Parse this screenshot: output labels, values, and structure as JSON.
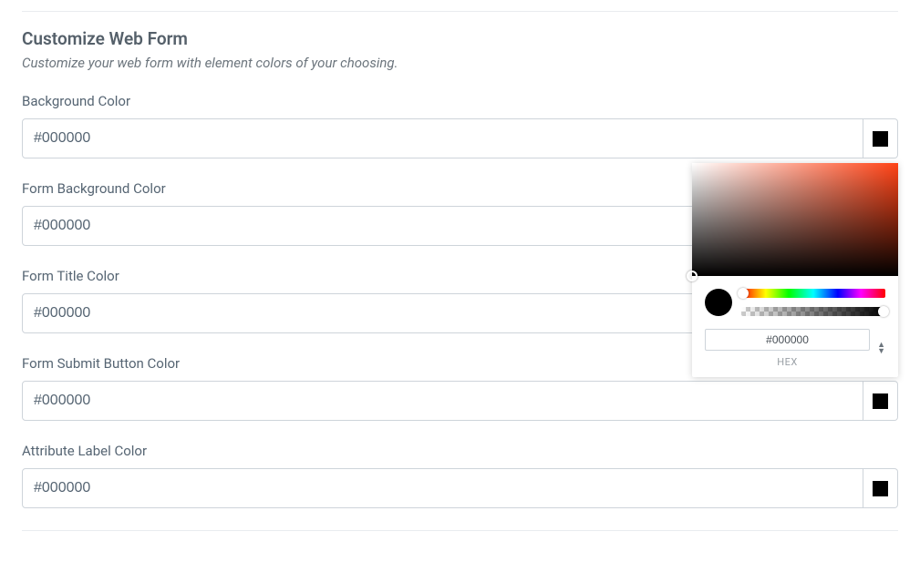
{
  "section": {
    "title": "Customize Web Form",
    "description": "Customize your web form with element colors of your choosing."
  },
  "fields": [
    {
      "label": "Background Color",
      "value": "#000000",
      "swatch": "#000000",
      "show_swatch": true
    },
    {
      "label": "Form Background Color",
      "value": "#000000",
      "swatch": "#000000",
      "show_swatch": false
    },
    {
      "label": "Form Title Color",
      "value": "#000000",
      "swatch": "#000000",
      "show_swatch": false
    },
    {
      "label": "Form Submit Button Color",
      "value": "#000000",
      "swatch": "#000000",
      "show_swatch": true
    },
    {
      "label": "Attribute Label Color",
      "value": "#000000",
      "swatch": "#000000",
      "show_swatch": true
    }
  ],
  "picker": {
    "hex_value": "#000000",
    "hex_label": "HEX",
    "preview": "#000000",
    "hue_base": "#ff4316"
  }
}
